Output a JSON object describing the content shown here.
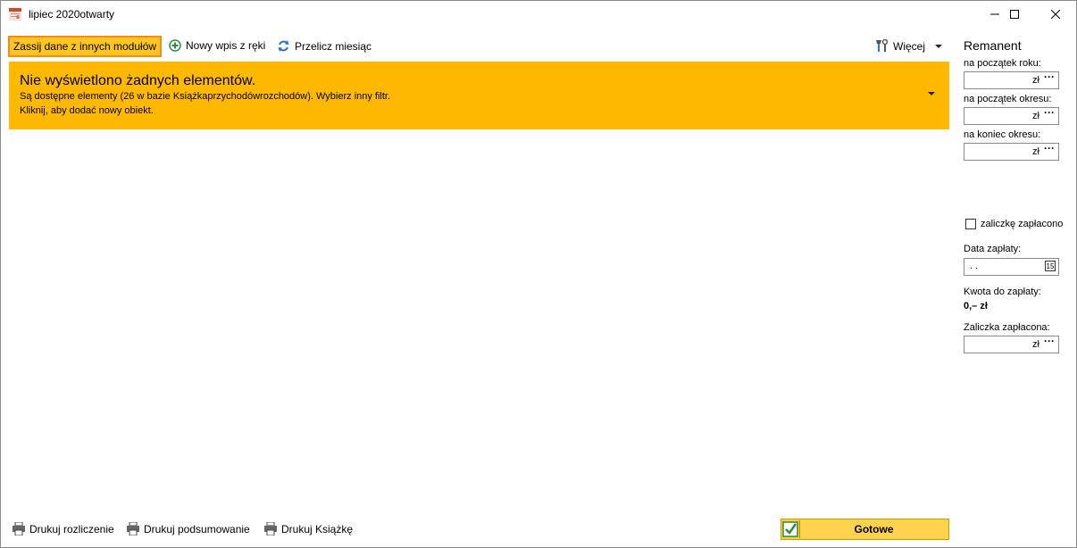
{
  "window": {
    "title": "lipiec 2020",
    "status": "otwarty"
  },
  "toolbar": {
    "sync_label": "Zassij dane z innych modułów",
    "new_entry_label": "Nowy wpis z ręki",
    "recalc_label": "Przelicz miesiąc",
    "more_label": "Więcej"
  },
  "banner": {
    "title": "Nie wyświetlono żadnych elementów.",
    "line1": "Są dostępne elementy (26 w bazie Książkaprzychodówrozchodów). Wybierz inny filtr.",
    "line2": "Kliknij, aby dodać nowy obiekt."
  },
  "side": {
    "title": "Remanent",
    "start_year_label": "na początek roku:",
    "start_year_value": "zł",
    "start_period_label": "na początek okresu:",
    "start_period_value": "zł",
    "end_period_label": "na koniec okresu:",
    "end_period_value": "zł",
    "paid_checkbox_label": "zaliczkę zapłacono",
    "paid_checkbox_checked": false,
    "payment_date_label": "Data zapłaty:",
    "payment_date_value": ". .",
    "calendar_day": "15",
    "amount_due_label": "Kwota do zapłaty:",
    "amount_due_value": "0,– zł",
    "advance_paid_label": "Zaliczka zapłacona:",
    "advance_paid_value": "zł",
    "ellipsis": "···"
  },
  "footer": {
    "print_settlement": "Drukuj rozliczenie",
    "print_summary": "Drukuj podsumowanie",
    "print_book": "Drukuj Książkę",
    "done_label": "Gotowe"
  },
  "colors": {
    "banner": "#ffb900",
    "sync_button_bg": "#ffc51f",
    "sync_button_border": "#f28a1e",
    "done_button": "#ffd34d"
  }
}
